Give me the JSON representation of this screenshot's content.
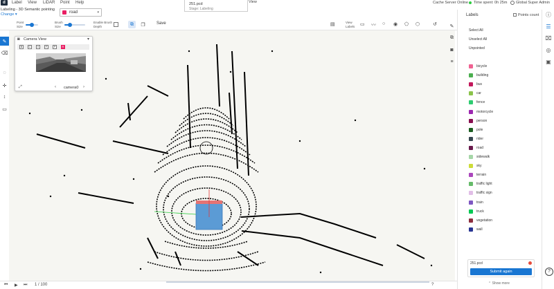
{
  "menubar": {
    "logo": "d",
    "items": [
      "Label",
      "View",
      "LiDAR",
      "Point",
      "Help"
    ],
    "file_name": "251.pcd",
    "stage": "Stage: Labeling",
    "view_link": "View",
    "cache_status": "Cache Server Online",
    "time_spent": "Time spent: 0h 25m",
    "user": "Global Super Admin"
  },
  "subheader": {
    "title": "Labeling - 3D Semantic pointing",
    "change": "Change",
    "selected_class": "road",
    "selected_class_color": "#e91e63"
  },
  "toolbar": {
    "point_size_label_1": "Point",
    "point_size_label_2": "Size",
    "point_size_value": 0.5,
    "brush_size_label_1": "Brush",
    "brush_size_label_2": "Size",
    "brush_size_value": 0.35,
    "enable_brush_depth_label_1": "Enable Brush",
    "enable_brush_depth_label_2": "Depth",
    "save": "Save",
    "view_labels_1": "View",
    "view_labels_2": "Labels"
  },
  "camera_view": {
    "title": "Camera View",
    "tabs": [
      "B",
      "C",
      "V",
      "F",
      "P",
      "R"
    ],
    "active_tab": 5,
    "camera_name": "camera0"
  },
  "bottombar": {
    "frame_text": "1 / 100"
  },
  "labels_panel": {
    "title": "Labels",
    "points_count": "Points count",
    "select_all": "Select All",
    "unselect_all": "Unselect All",
    "unpointed": "Unpointed",
    "labels": [
      {
        "name": "bicycle",
        "color": "#f06292"
      },
      {
        "name": "building",
        "color": "#4caf50"
      },
      {
        "name": "bus",
        "color": "#c2185b"
      },
      {
        "name": "car",
        "color": "#8bc34a"
      },
      {
        "name": "fence",
        "color": "#2ecc71"
      },
      {
        "name": "motorcycle",
        "color": "#9c27b0"
      },
      {
        "name": "person",
        "color": "#880e4f"
      },
      {
        "name": "pole",
        "color": "#1b5e20"
      },
      {
        "name": "rider",
        "color": "#37474f"
      },
      {
        "name": "road",
        "color": "#6a1b4d"
      },
      {
        "name": "sidewalk",
        "color": "#a5d6a7"
      },
      {
        "name": "sky",
        "color": "#cddc39"
      },
      {
        "name": "terrain",
        "color": "#ab47bc"
      },
      {
        "name": "traffic light",
        "color": "#66bb6a"
      },
      {
        "name": "traffic sign",
        "color": "#e1bee7"
      },
      {
        "name": "train",
        "color": "#7e57c2"
      },
      {
        "name": "truck",
        "color": "#00c853"
      },
      {
        "name": "vegetation",
        "color": "#8d2e3e"
      },
      {
        "name": "wall",
        "color": "#283593"
      }
    ],
    "submit_file": "251.pcd",
    "submit_button": "Submit again",
    "show_more": "Show more"
  },
  "accent_color": "#1976d2"
}
